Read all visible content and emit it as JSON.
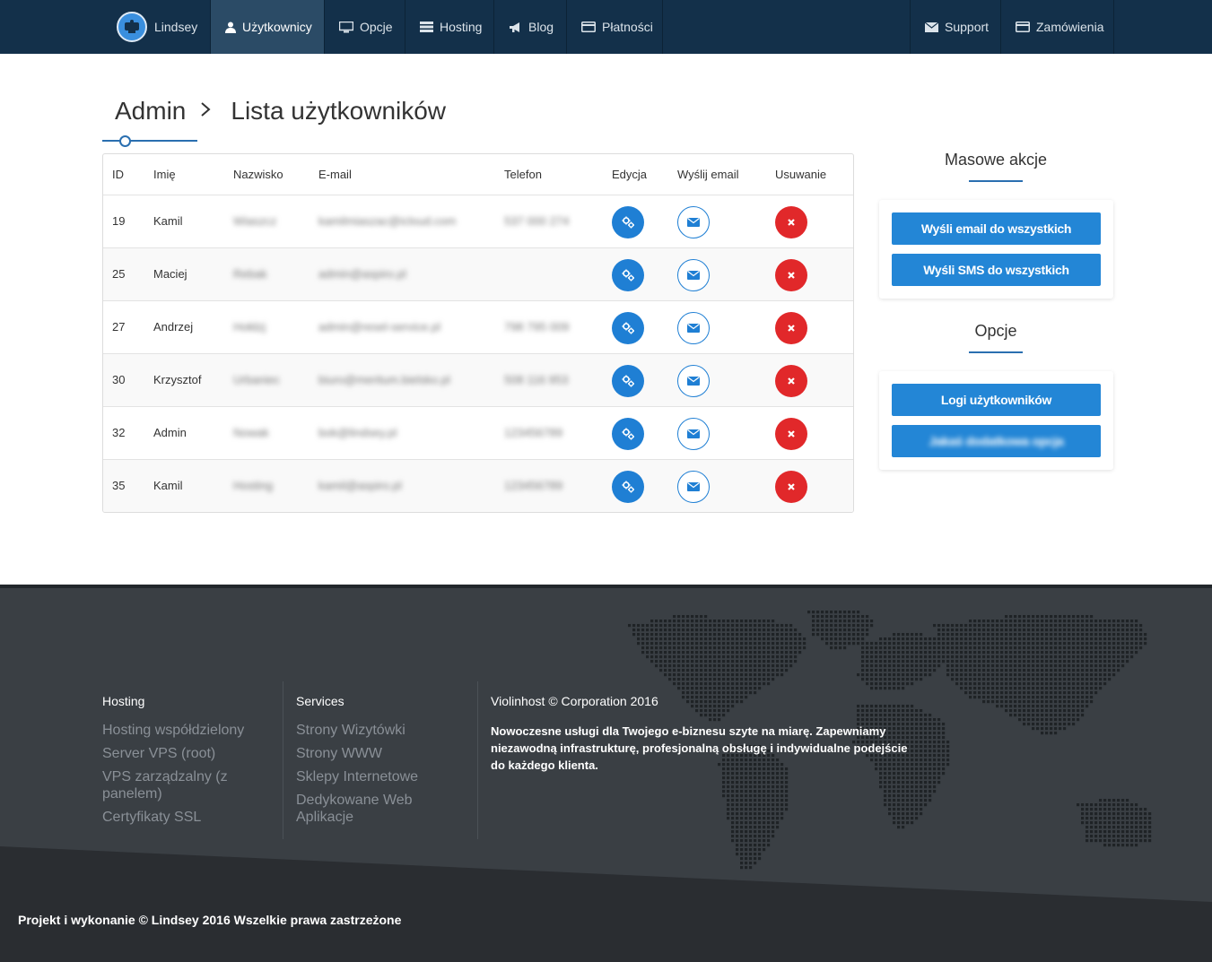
{
  "nav": {
    "brand": "Lindsey",
    "items": [
      {
        "label": "Użytkownicy",
        "icon": "user-icon"
      },
      {
        "label": "Opcje",
        "icon": "monitor-icon"
      },
      {
        "label": "Hosting",
        "icon": "server-icon"
      },
      {
        "label": "Blog",
        "icon": "megaphone-icon"
      },
      {
        "label": "Płatności",
        "icon": "credit-card-icon"
      }
    ],
    "right_items": [
      {
        "label": "Support",
        "icon": "envelope-icon"
      },
      {
        "label": "Zamówienia",
        "icon": "credit-card-icon"
      }
    ]
  },
  "breadcrumb": {
    "root": "Admin",
    "current": "Lista użytkowników"
  },
  "table": {
    "headers": [
      "ID",
      "Imię",
      "Nazwisko",
      "E-mail",
      "Telefon",
      "Edycja",
      "Wyślij email",
      "Usuwanie"
    ],
    "rows": [
      {
        "id": "19",
        "first": "Kamil",
        "last": "Wiaszcz",
        "email": "kamilmiaszac@icloud.com",
        "phone": "537 000 274"
      },
      {
        "id": "25",
        "first": "Maciej",
        "last": "Rebak",
        "email": "admin@aspiro.pl",
        "phone": ""
      },
      {
        "id": "27",
        "first": "Andrzej",
        "last": "Hołdzj",
        "email": "admin@resel-service.pl",
        "phone": "798 795 009"
      },
      {
        "id": "30",
        "first": "Krzysztof",
        "last": "Urbaniec",
        "email": "biuro@meritum.bielsko.pl",
        "phone": "508 116 953"
      },
      {
        "id": "32",
        "first": "Admin",
        "last": "Nowak",
        "email": "bok@lindsey.pl",
        "phone": "123456789"
      },
      {
        "id": "35",
        "first": "Kamil",
        "last": "Hosting",
        "email": "kamil@aspiro.pl",
        "phone": "123456789"
      }
    ]
  },
  "sidebar": {
    "mass_title": "Masowe akcje",
    "mass_buttons": [
      "Wyśli email do wszystkich",
      "Wyśli SMS do wszystkich"
    ],
    "options_title": "Opcje",
    "options_buttons": [
      "Logi użytkowników",
      "Jakaś dodatkowa opcja"
    ]
  },
  "footer": {
    "hosting": {
      "title": "Hosting",
      "links": [
        "Hosting współdzielony",
        "Server VPS (root)",
        "VPS zarządzalny (z panelem)",
        "Certyfikaty SSL"
      ]
    },
    "services": {
      "title": "Services",
      "links": [
        "Strony Wizytówki",
        "Strony WWW",
        "Sklepy Internetowe",
        "Dedykowane Web Aplikacje"
      ]
    },
    "company": {
      "title": "Violinhost © Corporation 2016",
      "description": "Nowoczesne usługi dla Twojego e-biznesu szyte na miarę. Zapewniamy niezawodną infrastrukturę, profesjonalną obsługę i indywidualne podejście do każdego klienta."
    },
    "copyright": "Projekt i wykonanie © Lindsey 2016 Wszelkie prawa zastrzeżone"
  },
  "colors": {
    "navbar": "#13304a",
    "accent": "#1f7fd4",
    "danger": "#e1282a",
    "footer": "#3a3f44"
  }
}
